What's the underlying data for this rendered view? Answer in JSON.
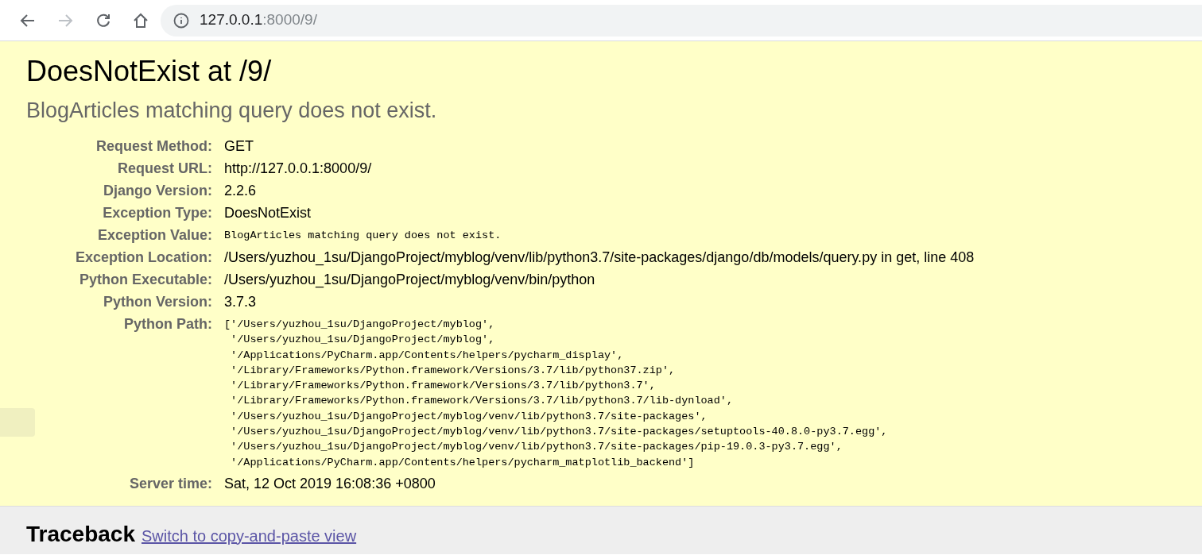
{
  "address_bar": {
    "host": "127.0.0.1",
    "path": ":8000/9/"
  },
  "title": "DoesNotExist at /9/",
  "subtitle": "BlogArticles matching query does not exist.",
  "meta": [
    {
      "label": "Request Method:",
      "kind": "text",
      "value": "GET"
    },
    {
      "label": "Request URL:",
      "kind": "text",
      "value": "http://127.0.0.1:8000/9/"
    },
    {
      "label": "Django Version:",
      "kind": "text",
      "value": "2.2.6"
    },
    {
      "label": "Exception Type:",
      "kind": "text",
      "value": "DoesNotExist"
    },
    {
      "label": "Exception Value:",
      "kind": "code",
      "value": "BlogArticles matching query does not exist."
    },
    {
      "label": "Exception Location:",
      "kind": "text",
      "value": "/Users/yuzhou_1su/DjangoProject/myblog/venv/lib/python3.7/site-packages/django/db/models/query.py in get, line 408"
    },
    {
      "label": "Python Executable:",
      "kind": "text",
      "value": "/Users/yuzhou_1su/DjangoProject/myblog/venv/bin/python"
    },
    {
      "label": "Python Version:",
      "kind": "text",
      "value": "3.7.3"
    },
    {
      "label": "Python Path:",
      "kind": "code",
      "value": "['/Users/yuzhou_1su/DjangoProject/myblog',\n '/Users/yuzhou_1su/DjangoProject/myblog',\n '/Applications/PyCharm.app/Contents/helpers/pycharm_display',\n '/Library/Frameworks/Python.framework/Versions/3.7/lib/python37.zip',\n '/Library/Frameworks/Python.framework/Versions/3.7/lib/python3.7',\n '/Library/Frameworks/Python.framework/Versions/3.7/lib/python3.7/lib-dynload',\n '/Users/yuzhou_1su/DjangoProject/myblog/venv/lib/python3.7/site-packages',\n '/Users/yuzhou_1su/DjangoProject/myblog/venv/lib/python3.7/site-packages/setuptools-40.8.0-py3.7.egg',\n '/Users/yuzhou_1su/DjangoProject/myblog/venv/lib/python3.7/site-packages/pip-19.0.3-py3.7.egg',\n '/Applications/PyCharm.app/Contents/helpers/pycharm_matplotlib_backend']"
    },
    {
      "label": "Server time:",
      "kind": "text",
      "value": "Sat, 12 Oct 2019 16:08:36 +0800"
    }
  ],
  "traceback": {
    "heading": "Traceback",
    "link": "Switch to copy-and-paste view"
  }
}
